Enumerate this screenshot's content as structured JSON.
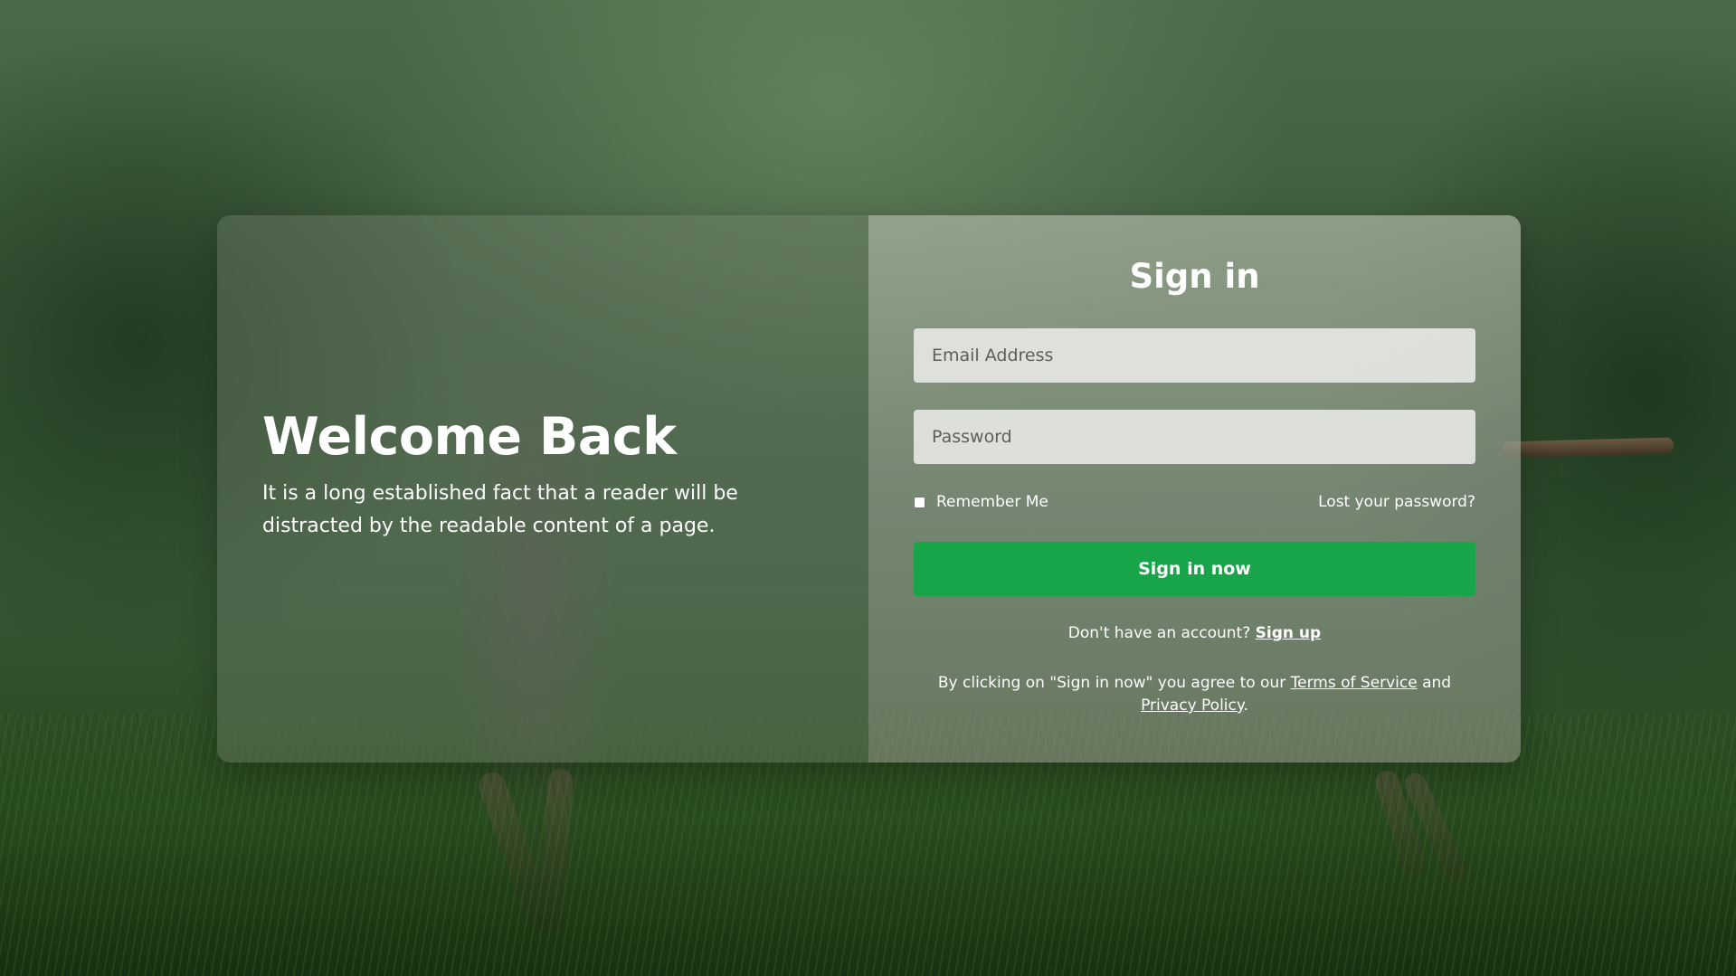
{
  "left_panel": {
    "title": "Welcome Back",
    "description": "It is a long established fact that a reader will be distracted by the readable content of a page."
  },
  "signin_form": {
    "title": "Sign in",
    "email_placeholder": "Email Address",
    "password_placeholder": "Password",
    "remember_label": "Remember Me",
    "remember_checked": false,
    "lost_password_label": "Lost your password?",
    "submit_label": "Sign in now",
    "signup_prompt": "Don't have an account?",
    "signup_link": "Sign up",
    "terms_prefix": "By clicking on \"Sign in now\" you agree to our",
    "terms_link": "Terms of Service",
    "terms_and": "and",
    "privacy_link": "Privacy Policy",
    "terms_suffix": "."
  },
  "colors": {
    "button": "#18a54a",
    "text": "#ffffff",
    "input_bg": "#ebebe8"
  }
}
